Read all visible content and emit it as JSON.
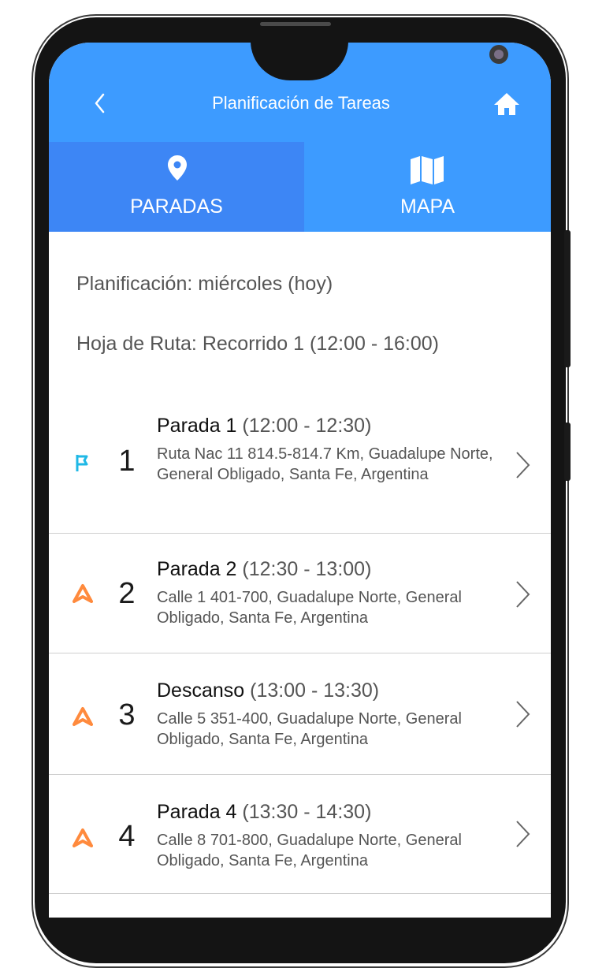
{
  "header": {
    "title": "Planificación de Tareas",
    "back_icon": "chevron-left-icon",
    "home_icon": "home-icon"
  },
  "tabs": [
    {
      "label": "PARADAS",
      "icon": "location-pin-icon",
      "active": true
    },
    {
      "label": "MAPA",
      "icon": "map-icon",
      "active": false
    }
  ],
  "plan": {
    "label": "Planificación:",
    "value": "miércoles (hoy)"
  },
  "route": {
    "label": "Hoja de Ruta:",
    "value": "Recorrido 1 (12:00 - 16:00)"
  },
  "colors": {
    "header_blue": "#3d9bff",
    "active_tab_blue": "#3d86f5",
    "flag_cyan": "#1fb8e6",
    "nav_orange": "#ff8a3d"
  },
  "stops": [
    {
      "number": "1",
      "name": "Parada 1",
      "time": "(12:00 - 12:30)",
      "address": "Ruta Nac 11 814.5-814.7 Km, Guadalupe Norte, General Obligado, Santa Fe, Argentina",
      "icon": "flag-icon"
    },
    {
      "number": "2",
      "name": "Parada 2",
      "time": "(12:30 - 13:00)",
      "address": "Calle 1 401-700, Guadalupe Norte, General Obligado, Santa Fe, Argentina",
      "icon": "navigation-arrow-icon"
    },
    {
      "number": "3",
      "name": "Descanso",
      "time": "(13:00 - 13:30)",
      "address": "Calle 5 351-400, Guadalupe Norte, General Obligado, Santa Fe, Argentina",
      "icon": "navigation-arrow-icon"
    },
    {
      "number": "4",
      "name": "Parada 4",
      "time": "(13:30 - 14:30)",
      "address": "Calle 8 701-800, Guadalupe Norte, General Obligado, Santa Fe, Argentina",
      "icon": "navigation-arrow-icon"
    }
  ]
}
